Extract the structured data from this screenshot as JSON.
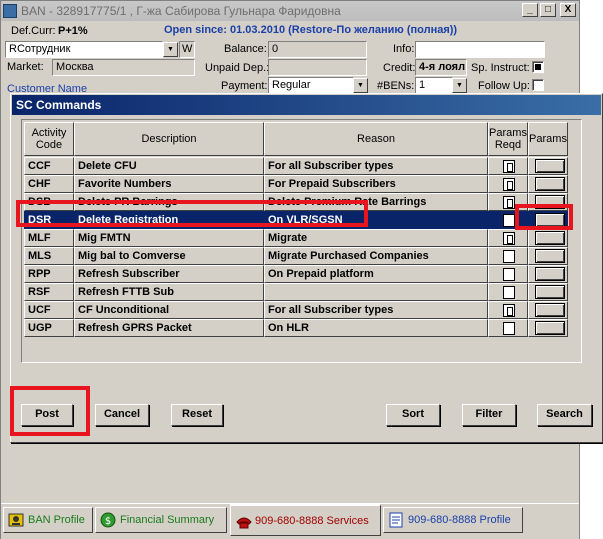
{
  "ban": {
    "title": "BAN - 328917775/1 , Г-жа Сабирова Гульнара Фаридовна",
    "window_buttons": [
      "_",
      "□",
      "X"
    ],
    "def_curr_label": "Def.Curr:",
    "def_curr_value": "P+1%",
    "open_since": "Open since: 01.03.2010 (Restore-По желанию (полная))",
    "role_value": "RСотрудник",
    "role_suffix": "W",
    "market_label": "Market:",
    "market_value": "Москва",
    "customer_name_label": "Customer Name",
    "balance_label": "Balance:",
    "balance_value": "0",
    "unpaid_label": "Unpaid Dep.:",
    "unpaid_value": "",
    "payment_label": "Payment:",
    "payment_value": "Regular",
    "info_label": "Info:",
    "info_value": "",
    "credit_label": "Credit:",
    "credit_value": "4-я лоял",
    "sp_instruct_label": "Sp. Instruct:",
    "bens_label": "#BENs:",
    "bens_value": "1",
    "follow_up_label": "Follow Up:"
  },
  "tabs": [
    {
      "label": "BAN Profile",
      "icon": "ban-profile-icon",
      "color": "#1b7a1b"
    },
    {
      "label": "Financial Summary",
      "icon": "money-icon",
      "color": "#1b7a1b"
    },
    {
      "label": "909-680-8888 Services",
      "icon": "phone-icon",
      "color": "#a00000"
    },
    {
      "label": "909-680-8888 Profile",
      "icon": "profile-doc-icon",
      "color": "#1a3fa8"
    }
  ],
  "dialog": {
    "title": "SC Commands",
    "columns": [
      "Activity Code",
      "Description",
      "Reason",
      "Params Reqd",
      "Params"
    ],
    "rows": [
      {
        "code": "CCF",
        "description": "Delete CFU",
        "reason": "For all Subscriber types",
        "reqd": true
      },
      {
        "code": "CHF",
        "description": "Favorite Numbers",
        "reason": "For Prepaid Subscribers",
        "reqd": true
      },
      {
        "code": "DSB",
        "description": "Delete PR Barrings",
        "reason": "Delete Premium Rate Barrings",
        "reqd": true
      },
      {
        "code": "DSR",
        "description": "Delete Registration",
        "reason": "On VLR/SGSN",
        "reqd": false
      },
      {
        "code": "MLF",
        "description": "Mig FMTN",
        "reason": "Migrate",
        "reqd": true
      },
      {
        "code": "MLS",
        "description": "Mig bal to Comverse",
        "reason": "Migrate Purchased Companies",
        "reqd": false
      },
      {
        "code": "RPP",
        "description": "Refresh Subscriber",
        "reason": "On Prepaid platform",
        "reqd": false
      },
      {
        "code": "RSF",
        "description": "Refresh FTTB Sub",
        "reason": "",
        "reqd": false
      },
      {
        "code": "UCF",
        "description": "CF Unconditional",
        "reason": "For all Subscriber types",
        "reqd": true
      },
      {
        "code": "UGP",
        "description": "Refresh GPRS Packet",
        "reason": "On HLR",
        "reqd": false
      }
    ],
    "selected_row": 3,
    "buttons": {
      "post": "Post",
      "cancel": "Cancel",
      "reset": "Reset",
      "sort": "Sort",
      "filter": "Filter",
      "search": "Search"
    },
    "highlight_color": "#e8151f"
  }
}
